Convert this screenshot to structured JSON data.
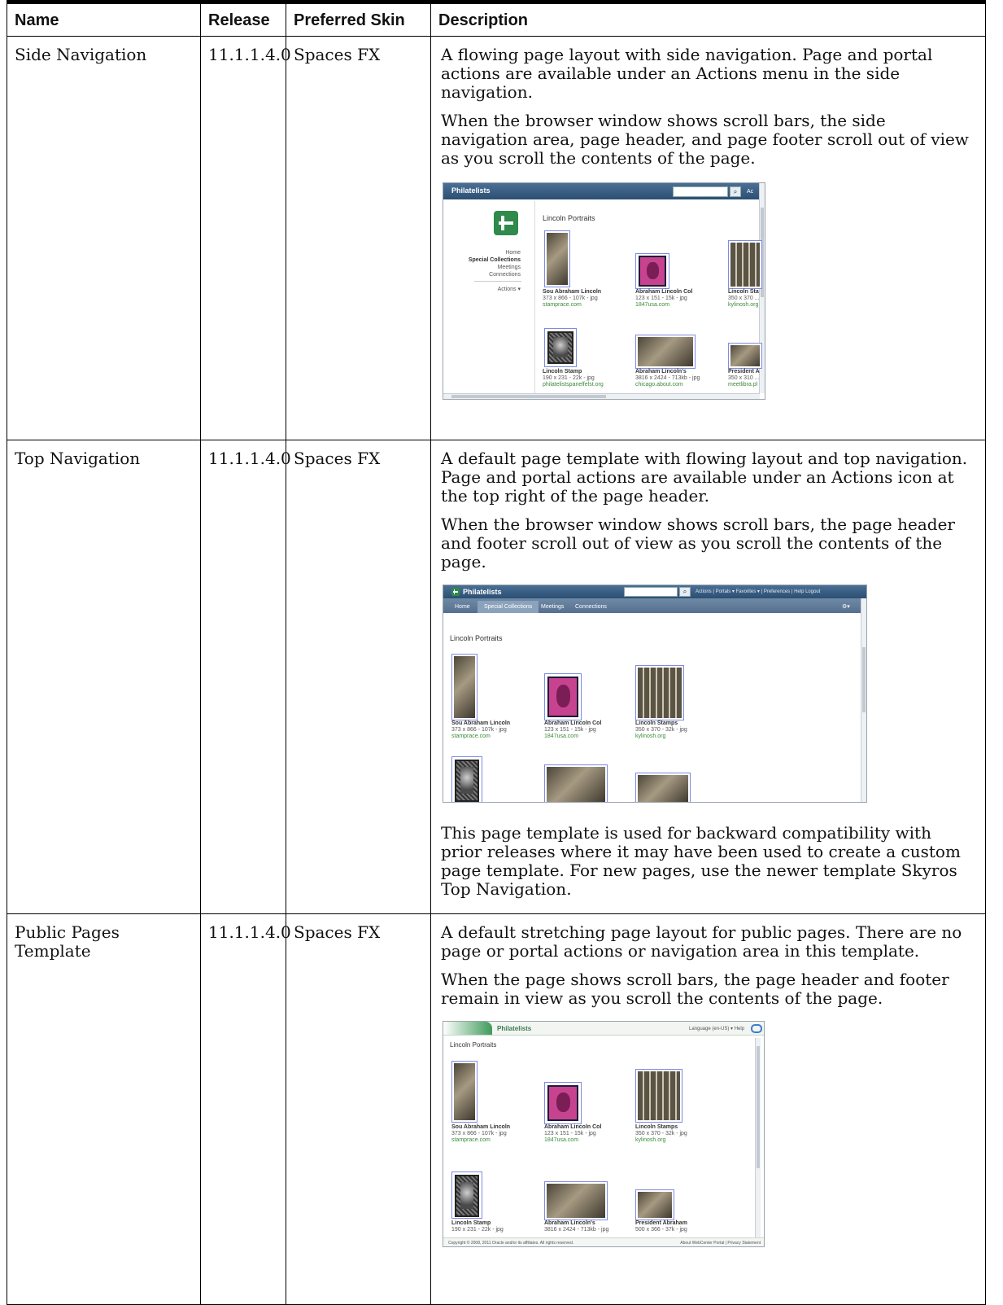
{
  "columns": [
    "Name",
    "Release",
    "Preferred Skin",
    "Description"
  ],
  "rows": [
    {
      "name": "Side Navigation",
      "release": "11.1.1.4.0",
      "skin": "Spaces FX",
      "desc1": "A flowing page layout with side navigation. Page and portal actions are available under an Actions menu in the side navigation.",
      "desc2": "When the browser window shows scroll bars, the side navigation area, page header, and page footer scroll out of view as you scroll the contents of the page.",
      "shot": {
        "app_title": "Philatelists",
        "header_action": "Ac",
        "heading": "Lincoln Portraits",
        "nav_items": [
          "Home",
          "Special Collections",
          "Meetings",
          "Connections"
        ],
        "nav_actions": "Actions ▾",
        "captions": [
          {
            "title": "Sou Abraham Lincoln",
            "meta": "373 x 866 - 107k - jpg",
            "site": "stamprace.com"
          },
          {
            "title": "Abraham Lincoln Col",
            "meta": "123 x 151 - 15k - jpg",
            "site": "1847usa.com"
          },
          {
            "title": "Lincoln Sta",
            "meta": "350 x 370 ...",
            "site": "kylinosh.org"
          },
          {
            "title": "Lincoln Stamp",
            "meta": "190 x 231 - 22k - jpg",
            "site": "philatelistspanelfelst.org"
          },
          {
            "title": "Abraham Lincoln's",
            "meta": "3816 x 2424 - 713kb - jpg",
            "site": "chicago.about.com"
          },
          {
            "title": "President A",
            "meta": "350 x 310 ...",
            "site": "meetlibra.pl"
          }
        ]
      }
    },
    {
      "name": "Top Navigation",
      "release": "11.1.1.4.0",
      "skin": "Spaces FX",
      "desc1": "A default page template with flowing layout and top navigation. Page and portal actions are available under an Actions icon at the top right of the page header.",
      "desc2": "When the browser window shows scroll bars, the page header and footer scroll out of view as you scroll the contents of the page.",
      "desc3": "This page template is used for backward compatibility with prior releases where it may have been used to create a custom page template. For new pages, use the newer template Skyros Top Navigation.",
      "shot": {
        "app_title": "Philatelists",
        "header_links": "Actions | Portals ▾ Favorites ▾ | Preferences | Help Logout",
        "tabs": [
          "Home",
          "Special Collections",
          "Meetings",
          "Connections"
        ],
        "heading": "Lincoln Portraits",
        "captions": [
          {
            "title": "Sou Abraham Lincoln",
            "meta": "373 x 866 - 107k - jpg",
            "site": "stamprace.com"
          },
          {
            "title": "Abraham Lincoln Col",
            "meta": "123 x 151 - 15k - jpg",
            "site": "1847usa.com"
          },
          {
            "title": "Lincoln Stamps",
            "meta": "350 x 370 - 32k - jpg",
            "site": "kylinosh.org"
          }
        ]
      }
    },
    {
      "name": "Public Pages Template",
      "release": "11.1.1.4.0",
      "skin": "Spaces FX",
      "desc1": "A default stretching page layout for public pages. There are no page or portal actions or navigation area in this template.",
      "desc2": "When the page shows scroll bars, the page header and footer remain in view as you scroll the contents of the page.",
      "shot": {
        "app_title": "Philatelists",
        "header_links": "Language (en-US) ▾  Help",
        "heading": "Lincoln Portraits",
        "captions": [
          {
            "title": "Sou Abraham Lincoln",
            "meta": "373 x 866 - 107k - jpg",
            "site": "stamprace.com"
          },
          {
            "title": "Abraham Lincoln Col",
            "meta": "123 x 151 - 15k - jpg",
            "site": "1847usa.com"
          },
          {
            "title": "Lincoln Stamps",
            "meta": "350 x 370 - 32k - jpg",
            "site": "kylinosh.org"
          },
          {
            "title": "Lincoln Stamp",
            "meta": "190 x 231 - 22k - jpg",
            "site": ""
          },
          {
            "title": "Abraham Lincoln's",
            "meta": "3816 x 2424 - 713kb - jpg",
            "site": ""
          },
          {
            "title": "President Abraham",
            "meta": "500 x 366 - 37k - jpg",
            "site": ""
          }
        ],
        "footer_left": "Copyright © 2008, 2011 Oracle and/or its affiliates. All rights reserved.",
        "footer_right": "About WebCenter Portal | Privacy Statement"
      }
    }
  ]
}
